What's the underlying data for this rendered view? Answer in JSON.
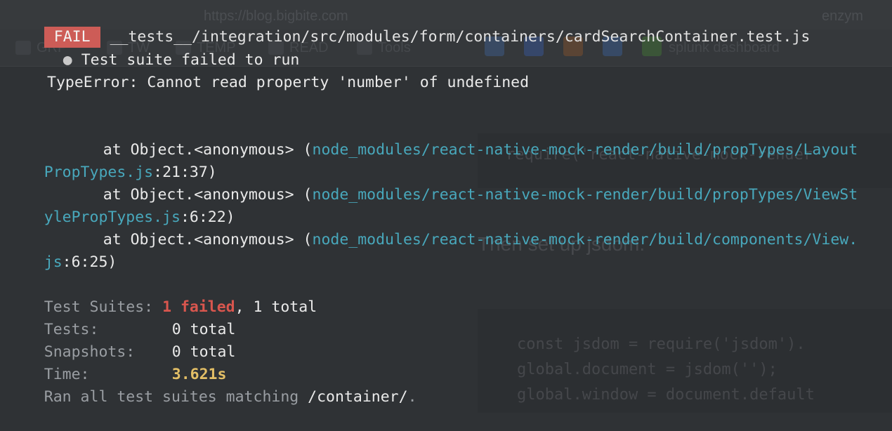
{
  "background_window": {
    "url_text": "https://blog.bigbite.com",
    "url_tail": "enzym",
    "bookmarks": [
      {
        "label": "GRP"
      },
      {
        "label": "TW"
      },
      {
        "label": "TEMP"
      },
      {
        "label": "READ"
      },
      {
        "label": "Tools"
      },
      {
        "label": "splunk dashboard"
      }
    ],
    "code_snippet_1": "require('react-native-mock-render",
    "prose": "Then set up jsdom.",
    "code_snippet_2": [
      "const jsdom = require('jsdom').",
      "global.document = jsdom('');",
      "global.window = document.default"
    ],
    "colors": {
      "extension_1": "#3d5a86",
      "extension_2": "#3a5fa0",
      "extension_3": "#9b5b2a",
      "extension_4": "#3f6b9e",
      "extension_5": "#4b8a3e"
    }
  },
  "terminal": {
    "status_badge": "FAIL",
    "test_file": "__tests__/integration/src/modules/form/containers/cardSearchContainer.test.js",
    "bullet": "●",
    "suite_message": "Test suite failed to run",
    "error_message": "TypeError: Cannot read property 'number' of undefined",
    "stack": [
      {
        "prefix": "at Object.<anonymous> (",
        "path_a": "node_modules/react-native-mock-render/build/propTypes/Layout",
        "path_b": "PropTypes.js",
        "loc": ":21:37)"
      },
      {
        "prefix": "at Object.<anonymous> (",
        "path_a": "node_modules/react-native-mock-render/build/propTypes/ViewSt",
        "path_b": "ylePropTypes.js",
        "loc": ":6:22)"
      },
      {
        "prefix": "at Object.<anonymous> (",
        "path_a": "node_modules/react-native-mock-render/build/components/View.",
        "path_b": "js",
        "loc": ":6:25)"
      }
    ],
    "summary": {
      "suites_label": "Test Suites:",
      "suites_failed": "1 failed",
      "suites_total": ", 1 total",
      "tests_label": "Tests:",
      "tests_value": "0 total",
      "snapshots_label": "Snapshots:",
      "snapshots_value": "0 total",
      "time_label": "Time:",
      "time_value": "3.621s",
      "ran_prefix": "Ran all test suites matching ",
      "ran_pattern": "/container/",
      "ran_suffix": "."
    },
    "colors": {
      "fail_badge": "#cd5c57",
      "path": "#48a8bc",
      "failed": "#d9564e",
      "time": "#e3bf66",
      "muted": "#9a9ea3"
    }
  }
}
